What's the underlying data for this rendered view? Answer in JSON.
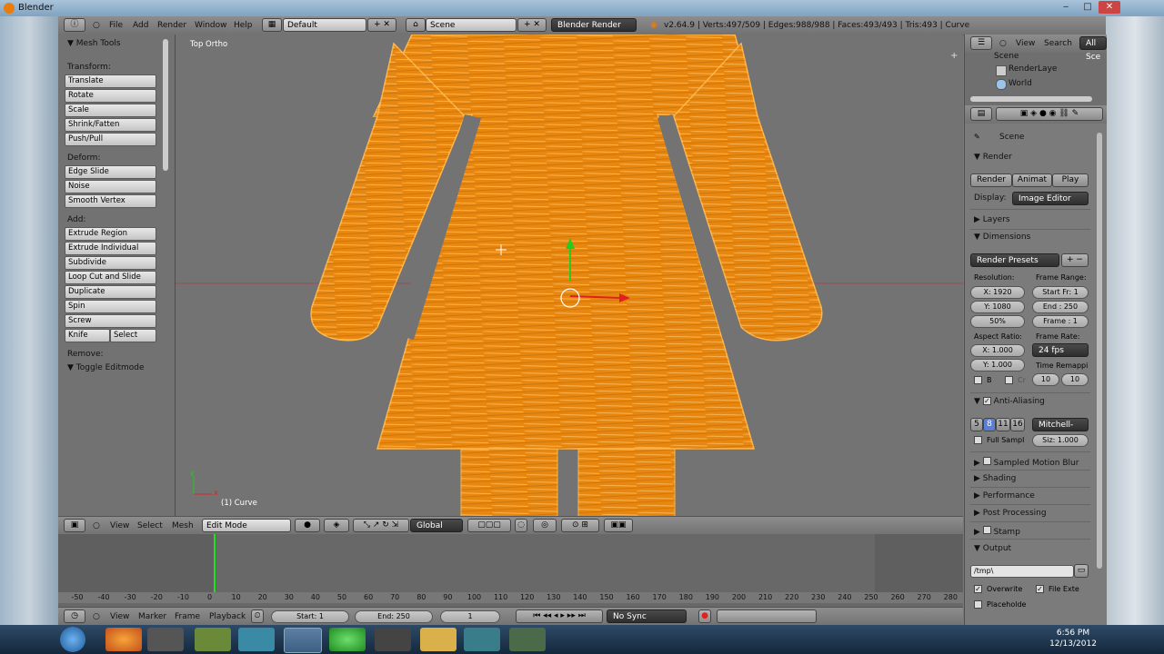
{
  "window": {
    "title": "Blender",
    "min": "‒",
    "max": "□",
    "close": "✕"
  },
  "info_header": {
    "menus": [
      "File",
      "Add",
      "Render",
      "Window",
      "Help"
    ],
    "layout": "Default",
    "scene": "Scene",
    "engine": "Blender Render",
    "stats": "v2.64.9 | Verts:497/509 | Edges:988/988 | Faces:493/493 | Tris:493 | Curve"
  },
  "tool_shelf": {
    "title": "Mesh Tools",
    "transform_label": "Transform:",
    "transform": [
      "Translate",
      "Rotate",
      "Scale",
      "Shrink/Fatten",
      "Push/Pull"
    ],
    "deform_label": "Deform:",
    "deform": [
      "Edge Slide",
      "Noise",
      "Smooth Vertex"
    ],
    "add_label": "Add:",
    "add": [
      "Extrude Region",
      "Extrude Individual",
      "Subdivide",
      "Loop Cut and Slide",
      "Duplicate",
      "Spin",
      "Screw"
    ],
    "knife": "Knife",
    "select": "Select",
    "remove_label": "Remove:",
    "toggle": "Toggle Editmode"
  },
  "viewport": {
    "view_label": "Top Ortho",
    "object_label": "(1) Curve",
    "axis_x": "x",
    "axis_y": "y"
  },
  "view3d_header": {
    "menus": [
      "View",
      "Select",
      "Mesh"
    ],
    "mode": "Edit Mode",
    "orientation": "Global"
  },
  "timeline": {
    "ruler": [
      "-50",
      "-40",
      "-30",
      "-20",
      "-10",
      "0",
      "10",
      "20",
      "30",
      "40",
      "50",
      "60",
      "70",
      "80",
      "90",
      "100",
      "110",
      "120",
      "130",
      "140",
      "150",
      "160",
      "170",
      "180",
      "190",
      "200",
      "210",
      "220",
      "230",
      "240",
      "250",
      "260",
      "270",
      "280"
    ],
    "menus": [
      "View",
      "Marker",
      "Frame",
      "Playback"
    ],
    "start": "Start: 1",
    "end": "End: 250",
    "current": "1",
    "sync": "No Sync"
  },
  "outliner": {
    "menus": [
      "View",
      "Search"
    ],
    "filter": "All Sce",
    "items": [
      "Scene",
      "RenderLaye",
      "World"
    ]
  },
  "properties": {
    "breadcrumb": "Scene",
    "render_panel": "Render",
    "render_btn": "Render",
    "anim_btn": "Animat",
    "play_btn": "Play",
    "display_label": "Display:",
    "display_value": "Image Editor",
    "layers": "Layers",
    "dimensions": "Dimensions",
    "presets": "Render Presets",
    "resolution_label": "Resolution:",
    "res_x": "X: 1920",
    "res_y": "Y: 1080",
    "res_pct": "50%",
    "frame_range_label": "Frame Range:",
    "start_fr": "Start Fr: 1",
    "end_fr": "End : 250",
    "frame": "Frame : 1",
    "aspect_label": "Aspect Ratio:",
    "asp_x": "X: 1.000",
    "asp_y": "Y: 1.000",
    "frame_rate_label": "Frame Rate:",
    "fps": "24 fps",
    "time_remap_label": "Time Remappi",
    "b_label": "B",
    "cr_label": "Cr",
    "remap_old": "10",
    "remap_new": "10",
    "aa": "Anti-Aliasing",
    "aa_samples": [
      "5",
      "8",
      "11",
      "16"
    ],
    "aa_filter": "Mitchell-Net",
    "full_sample": "Full Sampl",
    "size": "Siz: 1.000",
    "motion_blur": "Sampled Motion Blur",
    "shading": "Shading",
    "performance": "Performance",
    "post": "Post Processing",
    "stamp": "Stamp",
    "output": "Output",
    "path": "/tmp\\",
    "overwrite": "Overwrite",
    "file_ext": "File Exte",
    "placeholder": "Placeholde"
  },
  "taskbar": {
    "time": "6:56 PM",
    "date": "12/13/2012"
  },
  "colors": {
    "mesh_fill": "#e8870f",
    "mesh_edge": "#ffb84d",
    "header": "#7e7e7e"
  }
}
